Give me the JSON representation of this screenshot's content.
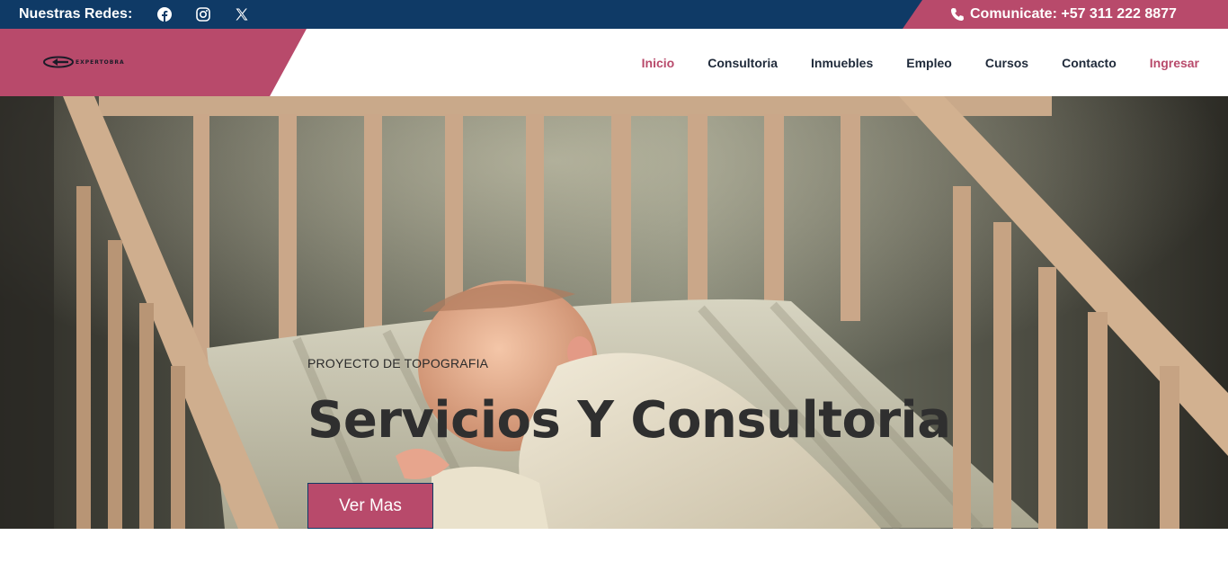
{
  "topbar": {
    "label": "Nuestras Redes:",
    "socials": [
      {
        "icon": "facebook-icon"
      },
      {
        "icon": "instagram-icon"
      },
      {
        "icon": "x-twitter-icon"
      }
    ],
    "contact": "Comunicate: +57 311 222 8877",
    "contact_icon": "phone-icon"
  },
  "header": {
    "logo_text": "EXPERTOBRA",
    "nav": [
      {
        "label": "Inicio",
        "active": true
      },
      {
        "label": "Consultoria"
      },
      {
        "label": "Inmuebles"
      },
      {
        "label": "Empleo"
      },
      {
        "label": "Cursos"
      },
      {
        "label": "Contacto"
      },
      {
        "label": "Ingresar"
      }
    ]
  },
  "hero": {
    "kicker": "PROYECTO DE TOPOGRAFIA",
    "title": "Servicios Y Consultoria",
    "button": "Ver Mas"
  },
  "colors": {
    "topbar": "#0f3a66",
    "accent": "#b84a6b",
    "nav_text": "#1f2a3a"
  }
}
